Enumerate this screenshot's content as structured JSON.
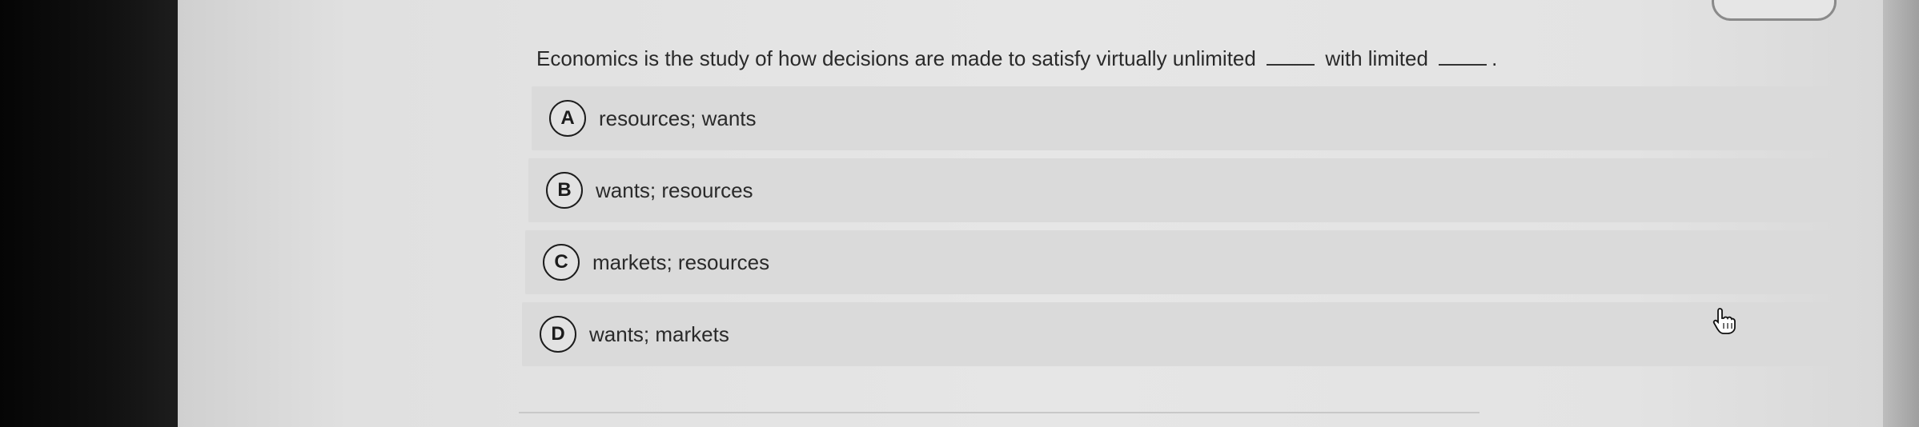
{
  "question": {
    "prefix": "Economics is the study of how decisions are made to satisfy virtually unlimited",
    "middle": "with limited",
    "suffix": "."
  },
  "options": [
    {
      "letter": "A",
      "text": "resources; wants"
    },
    {
      "letter": "B",
      "text": "wants; resources"
    },
    {
      "letter": "C",
      "text": "markets; resources"
    },
    {
      "letter": "D",
      "text": "wants; markets"
    }
  ],
  "icons": {
    "cursor": "hand-pointer-icon"
  }
}
